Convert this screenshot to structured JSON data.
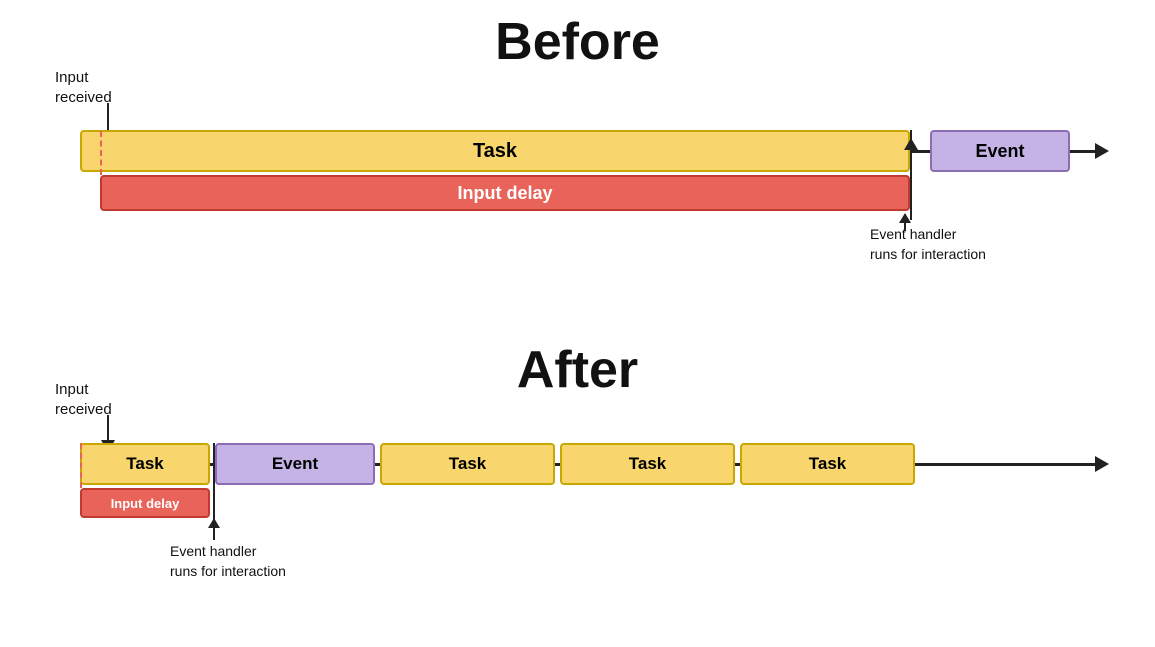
{
  "before": {
    "title": "Before",
    "input_received_label": "Input\nreceived",
    "task_label": "Task",
    "event_label": "Event",
    "input_delay_label": "Input delay",
    "event_handler_label": "Event handler\nruns for interaction"
  },
  "after": {
    "title": "After",
    "input_received_label": "Input\nreceived",
    "task_label": "Task",
    "event_label": "Event",
    "task2_label": "Task",
    "task3_label": "Task",
    "task4_label": "Task",
    "input_delay_label": "Input delay",
    "event_handler_label": "Event handler\nruns for interaction"
  }
}
